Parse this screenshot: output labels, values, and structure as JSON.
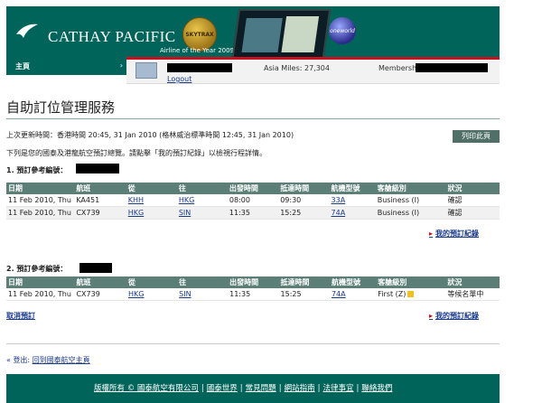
{
  "header": {
    "brand": "CATHAY PACIFIC",
    "award_badge": "SKYTRAX",
    "award_caption": "Airline of the Year 2009",
    "alliance": "oneworld"
  },
  "nav": {
    "home_label": "主頁",
    "home_arrow": "›"
  },
  "member": {
    "logout_label": "Logout",
    "asia_miles": "Asia Miles: 27,304",
    "membership_label": "Membership No. :"
  },
  "page": {
    "title": "自助訂位管理服務",
    "last_update": "上次更新時間：香港時間 20:45, 31 Jan 2010 (格林威治標準時間 12:45, 31 Jan 2010)",
    "print_label": "列印此頁",
    "description": "下列是您的國泰及港龍航空預訂總覽。請點擊「我的預訂紀錄」以檢視行程詳情。"
  },
  "table_headers": [
    "日期",
    "航班",
    "從",
    "往",
    "出發時間",
    "抵達時間",
    "航機型號",
    "客艙級別",
    "狀況"
  ],
  "bookings": [
    {
      "heading": "1. 預訂參考編號：",
      "rows": [
        [
          "11 Feb 2010, Thu",
          "KA451",
          "KHH",
          "HKG",
          "08:00",
          "09:30",
          "33A",
          "Business (I)",
          "確認"
        ],
        [
          "11 Feb 2010, Thu",
          "CX739",
          "HKG",
          "SIN",
          "11:35",
          "15:25",
          "74A",
          "Business (I)",
          "確認"
        ]
      ],
      "link_label": "我的預訂紀錄"
    },
    {
      "heading": "2. 預訂參考編號：",
      "rows": [
        [
          "11 Feb 2010, Thu",
          "CX739",
          "HKG",
          "SIN",
          "11:35",
          "15:25",
          "74A",
          "First (Z)",
          "等候名單中"
        ]
      ],
      "link_label": "我的預訂紀錄"
    }
  ],
  "cancel_label": "取消預訂",
  "logout_home": {
    "prefix": "« 登出: ",
    "link": "回到國泰航空主頁"
  },
  "footer": {
    "links": [
      "版權所有 © 國泰航空有限公司",
      "國泰世界",
      "常見問題",
      "網站指南",
      "法律事宜",
      "聯絡我們"
    ],
    "separator": "|"
  },
  "colors": {
    "brand_green": "#00645a",
    "accent_red": "#c8101e",
    "table_header": "#5b7e76"
  }
}
